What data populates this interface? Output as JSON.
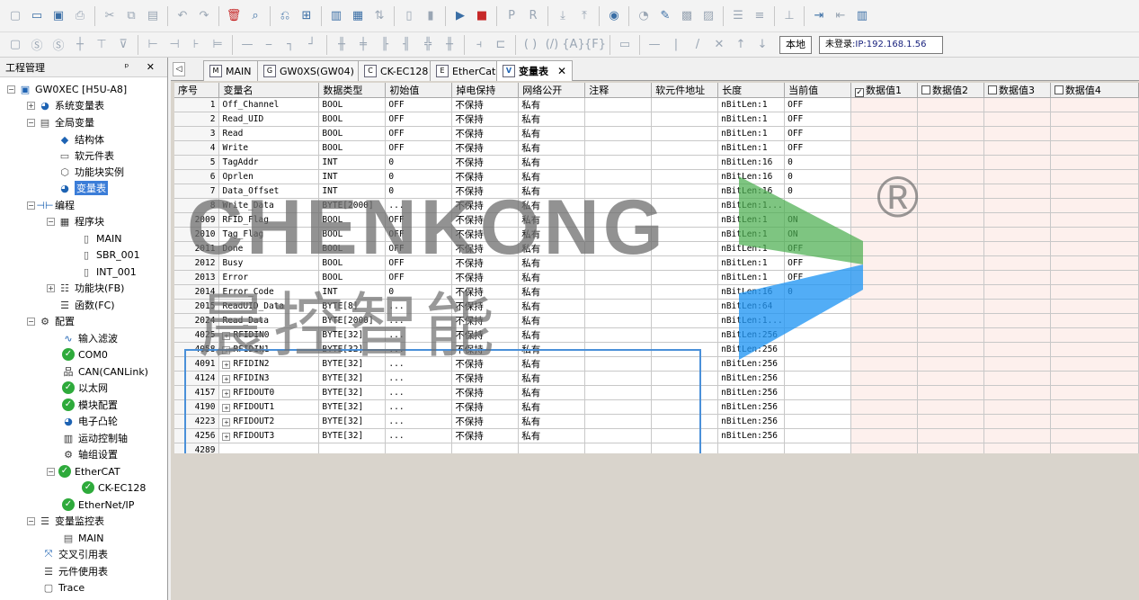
{
  "toolbar": {
    "station_button": "本地",
    "login_status": "未登录",
    "ip_label": ":IP:192.168.1.56"
  },
  "panel": {
    "title": "工程管理",
    "controls": "ᵖ ✕"
  },
  "tree": {
    "project": "GW0XEC [H5U-A8]",
    "system_vars": "系统变量表",
    "global_vars": "全局变量",
    "struct": "结构体",
    "soft_elem": "软元件表",
    "fb_instance": "功能块实例",
    "var_table": "变量表",
    "programming": "编程",
    "program_blocks": "程序块",
    "main": "MAIN",
    "sbr": "SBR_001",
    "int": "INT_001",
    "fb": "功能块(FB)",
    "fc": "函数(FC)",
    "config": "配置",
    "input_filter": "输入滤波",
    "com0": "COM0",
    "can": "CAN(CANLink)",
    "ethernet": "以太网",
    "module_config": "模块配置",
    "cam": "电子凸轮",
    "motion_axis": "运动控制轴",
    "axis_group": "轴组设置",
    "ethercat": "EtherCAT",
    "ck": "CK-EC128",
    "ethernetip": "EtherNet/IP",
    "monitor": "变量监控表",
    "monitor_main": "MAIN",
    "xref": "交叉引用表",
    "elem_usage": "元件使用表",
    "trace": "Trace"
  },
  "tabs": [
    {
      "label": "MAIN",
      "icon": "M"
    },
    {
      "label": "GW0XS(GW04)",
      "icon": "G"
    },
    {
      "label": "CK-EC128",
      "icon": "C"
    },
    {
      "label": "EtherCat",
      "icon": "E"
    },
    {
      "label": "变量表",
      "icon": "V"
    }
  ],
  "columns": [
    "序号",
    "变量名",
    "数据类型",
    "初始值",
    "掉电保持",
    "网络公开",
    "注释",
    "软元件地址",
    "长度",
    "当前值",
    "数据值1",
    "数据值2",
    "数据值3",
    "数据值4"
  ],
  "rows": [
    [
      "1",
      "Off_Channel",
      "BOOL",
      "OFF",
      "不保持",
      "私有",
      "",
      "",
      "nBitLen:1",
      "OFF"
    ],
    [
      "2",
      "Read_UID",
      "BOOL",
      "OFF",
      "不保持",
      "私有",
      "",
      "",
      "nBitLen:1",
      "OFF"
    ],
    [
      "3",
      "Read",
      "BOOL",
      "OFF",
      "不保持",
      "私有",
      "",
      "",
      "nBitLen:1",
      "OFF"
    ],
    [
      "4",
      "Write",
      "BOOL",
      "OFF",
      "不保持",
      "私有",
      "",
      "",
      "nBitLen:1",
      "OFF"
    ],
    [
      "5",
      "TagAddr",
      "INT",
      "0",
      "不保持",
      "私有",
      "",
      "",
      "nBitLen:16",
      "0"
    ],
    [
      "6",
      "Oprlen",
      "INT",
      "0",
      "不保持",
      "私有",
      "",
      "",
      "nBitLen:16",
      "0"
    ],
    [
      "7",
      "Data_Offset",
      "INT",
      "0",
      "不保持",
      "私有",
      "",
      "",
      "nBitLen:16",
      "0"
    ],
    [
      "8",
      "Write_Data",
      "BYTE[2000]",
      "...",
      "不保持",
      "私有",
      "",
      "",
      "nBitLen:1...",
      ""
    ],
    [
      "2009",
      "RFID_Flag",
      "BOOL",
      "OFF",
      "不保持",
      "私有",
      "",
      "",
      "nBitLen:1",
      "ON"
    ],
    [
      "2010",
      "Tag_Flag",
      "BOOL",
      "OFF",
      "不保持",
      "私有",
      "",
      "",
      "nBitLen:1",
      "ON"
    ],
    [
      "2011",
      "Done",
      "BOOL",
      "OFF",
      "不保持",
      "私有",
      "",
      "",
      "nBitLen:1",
      "OFF"
    ],
    [
      "2012",
      "Busy",
      "BOOL",
      "OFF",
      "不保持",
      "私有",
      "",
      "",
      "nBitLen:1",
      "OFF"
    ],
    [
      "2013",
      "Error",
      "BOOL",
      "OFF",
      "不保持",
      "私有",
      "",
      "",
      "nBitLen:1",
      "OFF"
    ],
    [
      "2014",
      "Error_Code",
      "INT",
      "0",
      "不保持",
      "私有",
      "",
      "",
      "nBitLen:16",
      "0"
    ],
    [
      "2015",
      "ReadUID_Data",
      "BYTE[8]",
      "...",
      "不保持",
      "私有",
      "",
      "",
      "nBitLen:64",
      ""
    ],
    [
      "2024",
      "Read_Data",
      "BYTE[2000]",
      "...",
      "不保持",
      "私有",
      "",
      "",
      "nBitLen:1...",
      ""
    ],
    [
      "4025",
      "RFIDIN0",
      "BYTE[32]",
      "...",
      "不保持",
      "私有",
      "",
      "",
      "nBitLen:256",
      ""
    ],
    [
      "4058",
      "RFIDIN1",
      "BYTE[32]",
      "...",
      "不保持",
      "私有",
      "",
      "",
      "nBitLen:256",
      ""
    ],
    [
      "4091",
      "RFIDIN2",
      "BYTE[32]",
      "...",
      "不保持",
      "私有",
      "",
      "",
      "nBitLen:256",
      ""
    ],
    [
      "4124",
      "RFIDIN3",
      "BYTE[32]",
      "...",
      "不保持",
      "私有",
      "",
      "",
      "nBitLen:256",
      ""
    ],
    [
      "4157",
      "RFIDOUT0",
      "BYTE[32]",
      "...",
      "不保持",
      "私有",
      "",
      "",
      "nBitLen:256",
      ""
    ],
    [
      "4190",
      "RFIDOUT1",
      "BYTE[32]",
      "...",
      "不保持",
      "私有",
      "",
      "",
      "nBitLen:256",
      ""
    ],
    [
      "4223",
      "RFIDOUT2",
      "BYTE[32]",
      "...",
      "不保持",
      "私有",
      "",
      "",
      "nBitLen:256",
      ""
    ],
    [
      "4256",
      "RFIDOUT3",
      "BYTE[32]",
      "...",
      "不保持",
      "私有",
      "",
      "",
      "nBitLen:256",
      ""
    ],
    [
      "4289",
      "",
      "",
      "",
      "",
      "",
      "",
      "",
      "",
      ""
    ]
  ],
  "expandable_from": 16,
  "data_value_checks": [
    true,
    false,
    false,
    false
  ],
  "watermark": {
    "brand": "CHENKONG",
    "brand_cn": "晨控智能",
    "registered": "®",
    "colors": {
      "green": "#4caf50",
      "blue": "#2196f3",
      "gray": "#6e6e6e"
    }
  }
}
